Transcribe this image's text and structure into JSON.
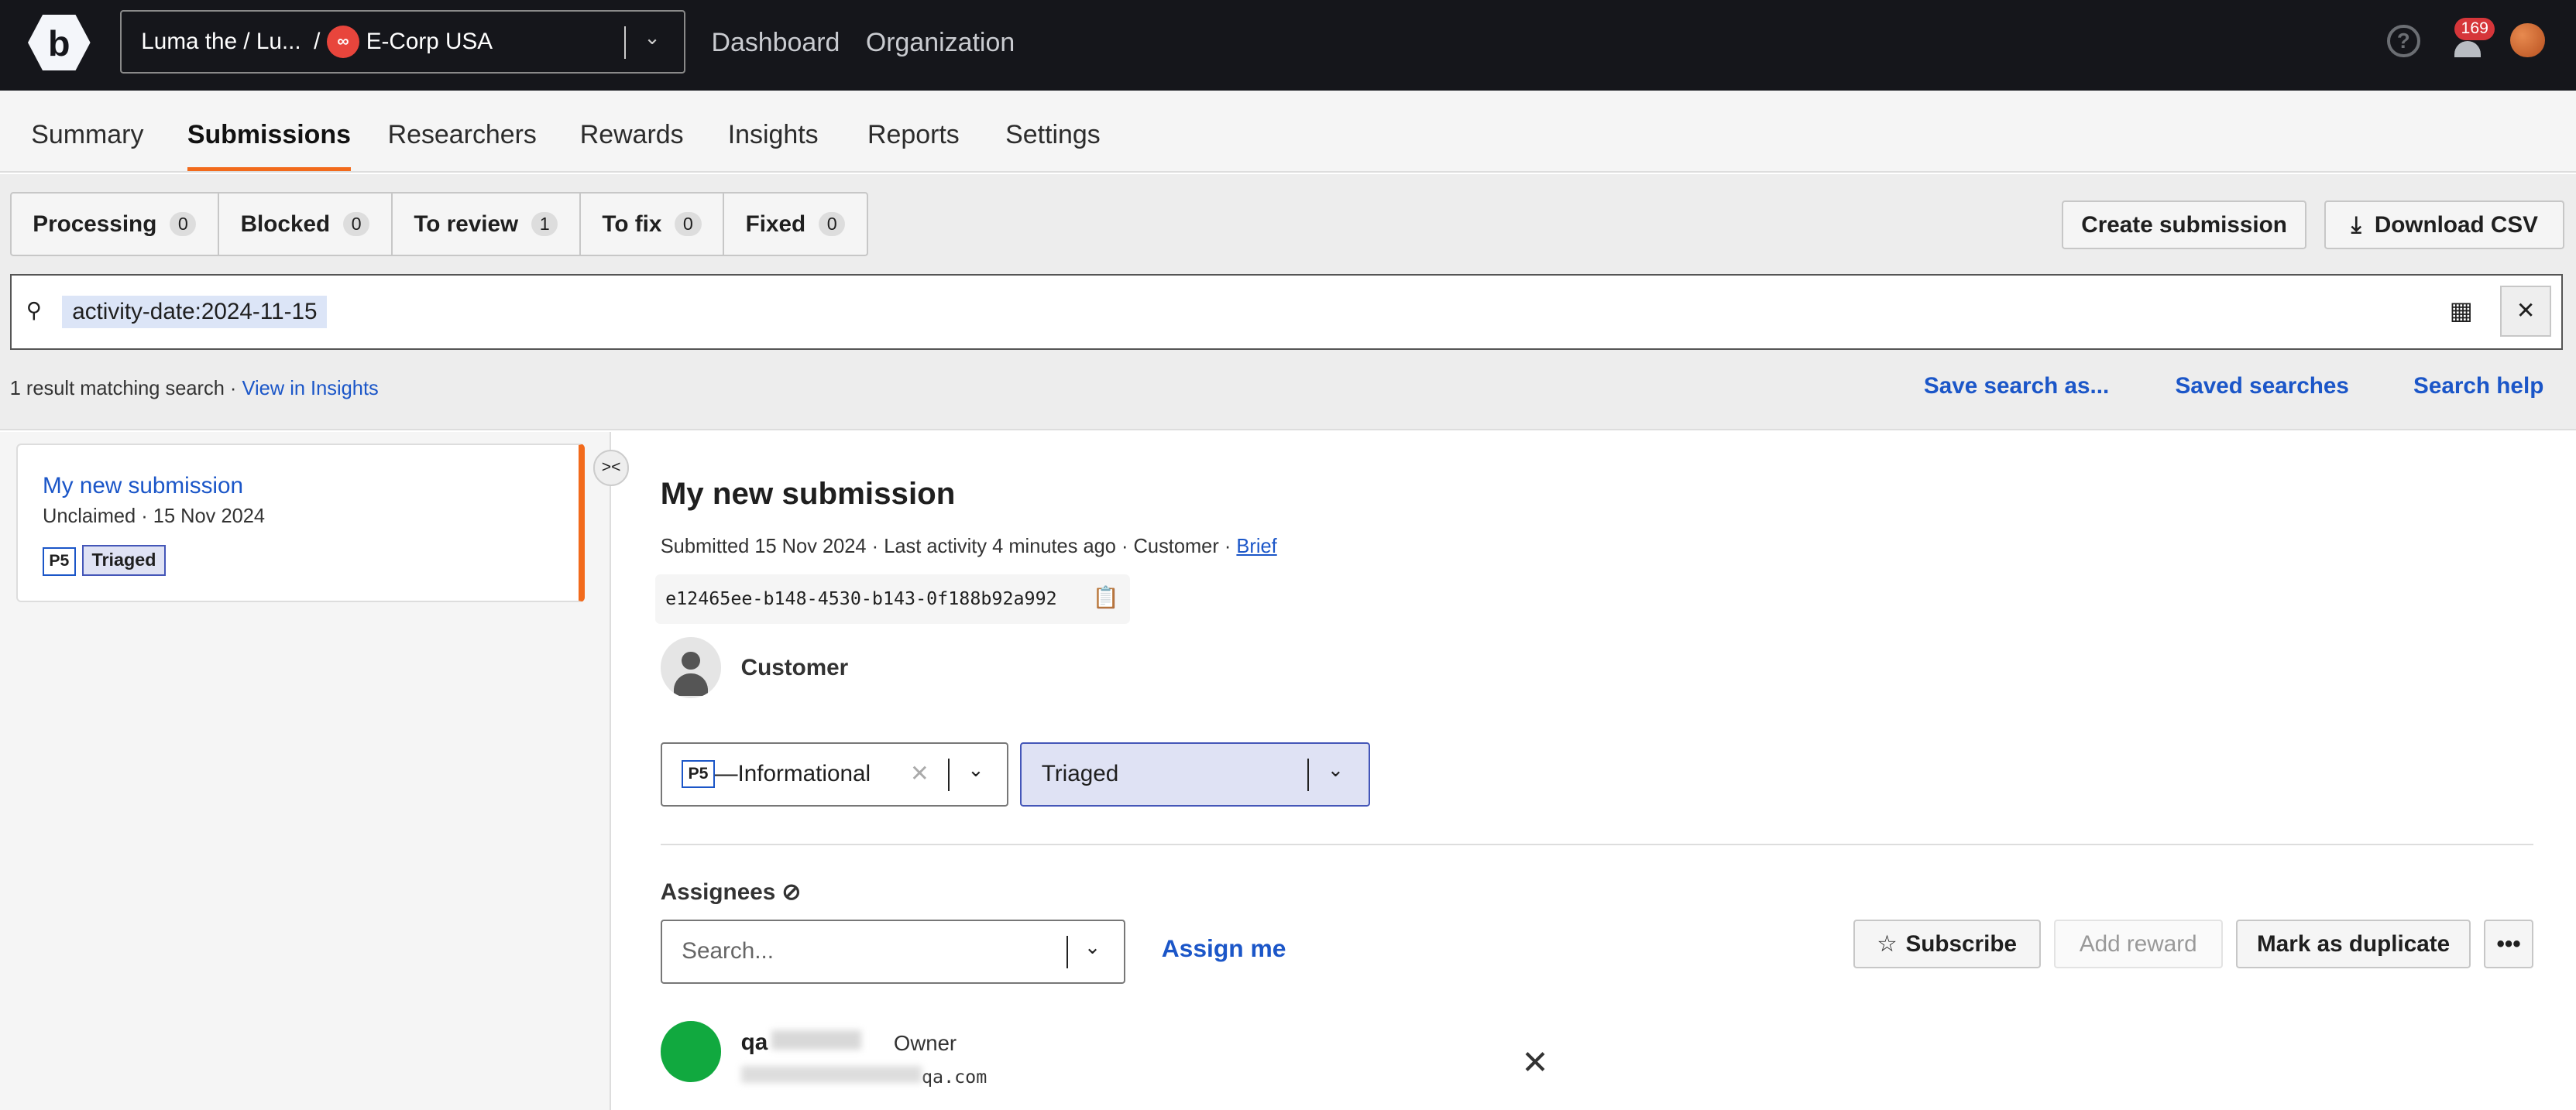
{
  "topbar": {
    "org_path": "Luma the / Lu...",
    "org_sep": "/",
    "company": "E-Corp USA",
    "nav": [
      "Dashboard",
      "Organization"
    ],
    "notifications": "169"
  },
  "tabs": [
    "Summary",
    "Submissions",
    "Researchers",
    "Rewards",
    "Insights",
    "Reports",
    "Settings"
  ],
  "active_tab": "Submissions",
  "filters": [
    {
      "label": "Processing",
      "count": "0"
    },
    {
      "label": "Blocked",
      "count": "0"
    },
    {
      "label": "To review",
      "count": "1"
    },
    {
      "label": "To fix",
      "count": "0"
    },
    {
      "label": "Fixed",
      "count": "0"
    }
  ],
  "actions": {
    "create": "Create submission",
    "download": "Download CSV"
  },
  "search": {
    "query": "activity-date:2024-11-15"
  },
  "results": {
    "count": "1 result matching search",
    "view_insights": "View in Insights",
    "save_search": "Save search as...",
    "saved_searches": "Saved searches",
    "search_help": "Search help"
  },
  "list": [
    {
      "title": "My new submission",
      "status": "Unclaimed",
      "date": "15 Nov 2024",
      "priority": "P5",
      "state": "Triaged"
    }
  ],
  "detail": {
    "title": "My new submission",
    "submitted": "Submitted 15 Nov 2024",
    "last_activity": "Last activity 4 minutes ago",
    "source": "Customer",
    "brief": "Brief",
    "uuid": "e12465ee-b148-4530-b143-0f188b92a992",
    "reporter": "Customer",
    "priority": "P5",
    "priority_label": "—Informational",
    "state": "Triaged",
    "assignees_label": "Assignees",
    "assignee_placeholder": "Search...",
    "assign_me": "Assign me",
    "subscribe": "Subscribe",
    "add_reward": "Add reward",
    "mark_duplicate": "Mark as duplicate",
    "assignee": {
      "name": "qa",
      "role": "Owner",
      "email": "qa.com"
    }
  }
}
